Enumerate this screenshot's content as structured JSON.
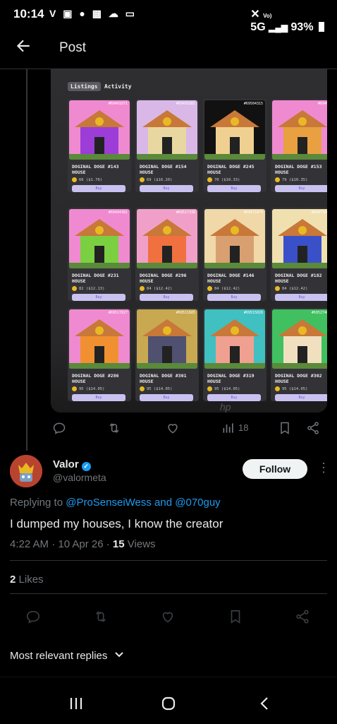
{
  "status_bar": {
    "time": "10:14",
    "left_icons": "V",
    "network": "5G",
    "battery": "93%"
  },
  "header": {
    "title": "Post"
  },
  "media": {
    "tabs": [
      "Listings",
      "Activity"
    ],
    "cards": [
      {
        "id": "#69491871",
        "label": "DOGINAL DOGE #143 HOUSE",
        "price": "66 ($1.76)",
        "buy": "Buy",
        "bg": "#f08ad0",
        "wall": "#9b3dd6"
      },
      {
        "id": "#69491881",
        "label": "DOGINAL DOGE #154 HOUSE",
        "price": "69 ($16.20)",
        "buy": "Buy",
        "bg": "#d9b8e8",
        "wall": "#e8d7a0"
      },
      {
        "id": "#69504315",
        "label": "DOGINAL DOGE #245 HOUSE",
        "price": "70 ($10.33)",
        "buy": "Buy",
        "bg": "#111111",
        "wall": "#f0d090"
      },
      {
        "id": "#69491",
        "label": "DOGINAL DOGE #153 HOUSE",
        "price": "79 ($10.35)",
        "buy": "Buy",
        "bg": "#f08ad0",
        "wall": "#e8a040"
      },
      {
        "id": "#69494381",
        "label": "DOGINAL DOGE #231 HOUSE",
        "price": "82 ($12.13)",
        "buy": "Buy",
        "bg": "#f08ad0",
        "wall": "#7ad040"
      },
      {
        "id": "#69517338",
        "label": "DOGINAL DOGE #296 HOUSE",
        "price": "84 ($12.42)",
        "buy": "Buy",
        "bg": "#f0a0c8",
        "wall": "#f07040"
      },
      {
        "id": "#69471874",
        "label": "DOGINAL DOGE #146 HOUSE",
        "price": "84 ($12.42)",
        "buy": "Buy",
        "bg": "#f0d8a8",
        "wall": "#d8a070"
      },
      {
        "id": "#69473425",
        "label": "DOGINAL DOGE #182 HOUSE",
        "price": "84 ($12.42)",
        "buy": "Buy",
        "bg": "#f0e0b0",
        "wall": "#3a50c8"
      },
      {
        "id": "#69517827",
        "label": "DOGINAL DOGE #286 HOUSE",
        "price": "95 ($14.05)",
        "buy": "Buy",
        "bg": "#f08ad0",
        "wall": "#f09030"
      },
      {
        "id": "#69511685",
        "label": "DOGINAL DOGE #301 HOUSE",
        "price": "95 ($14.05)",
        "buy": "Buy",
        "bg": "#c8a850",
        "wall": "#505070"
      },
      {
        "id": "#69515026",
        "label": "DOGINAL DOGE #319 HOUSE",
        "price": "95 ($14.05)",
        "buy": "Buy",
        "bg": "#40c0c0",
        "wall": "#f0a090"
      },
      {
        "id": "#69527484",
        "label": "DOGINAL DOGE #302 HOUSE",
        "price": "95 ($14.05)",
        "buy": "Buy",
        "bg": "#40c060",
        "wall": "#f0e0c0"
      }
    ]
  },
  "actions": {
    "views": "18"
  },
  "reply": {
    "author_name": "Valor",
    "author_handle": "@valormeta",
    "follow_label": "Follow",
    "replying_prefix": "Replying to",
    "replying_mentions": "@ProSenseiWess and @070guy",
    "text": "I dumped my houses, I know the creator",
    "time": "4:22 AM · 10 Apr 26 ·",
    "views_count": "15",
    "views_label": "Views",
    "likes_count": "2",
    "likes_label": "Likes"
  },
  "sort": {
    "label": "Most relevant replies"
  },
  "colors": {
    "accent": "#1d9bf0",
    "muted": "#71767b",
    "text": "#e7e9ea"
  }
}
